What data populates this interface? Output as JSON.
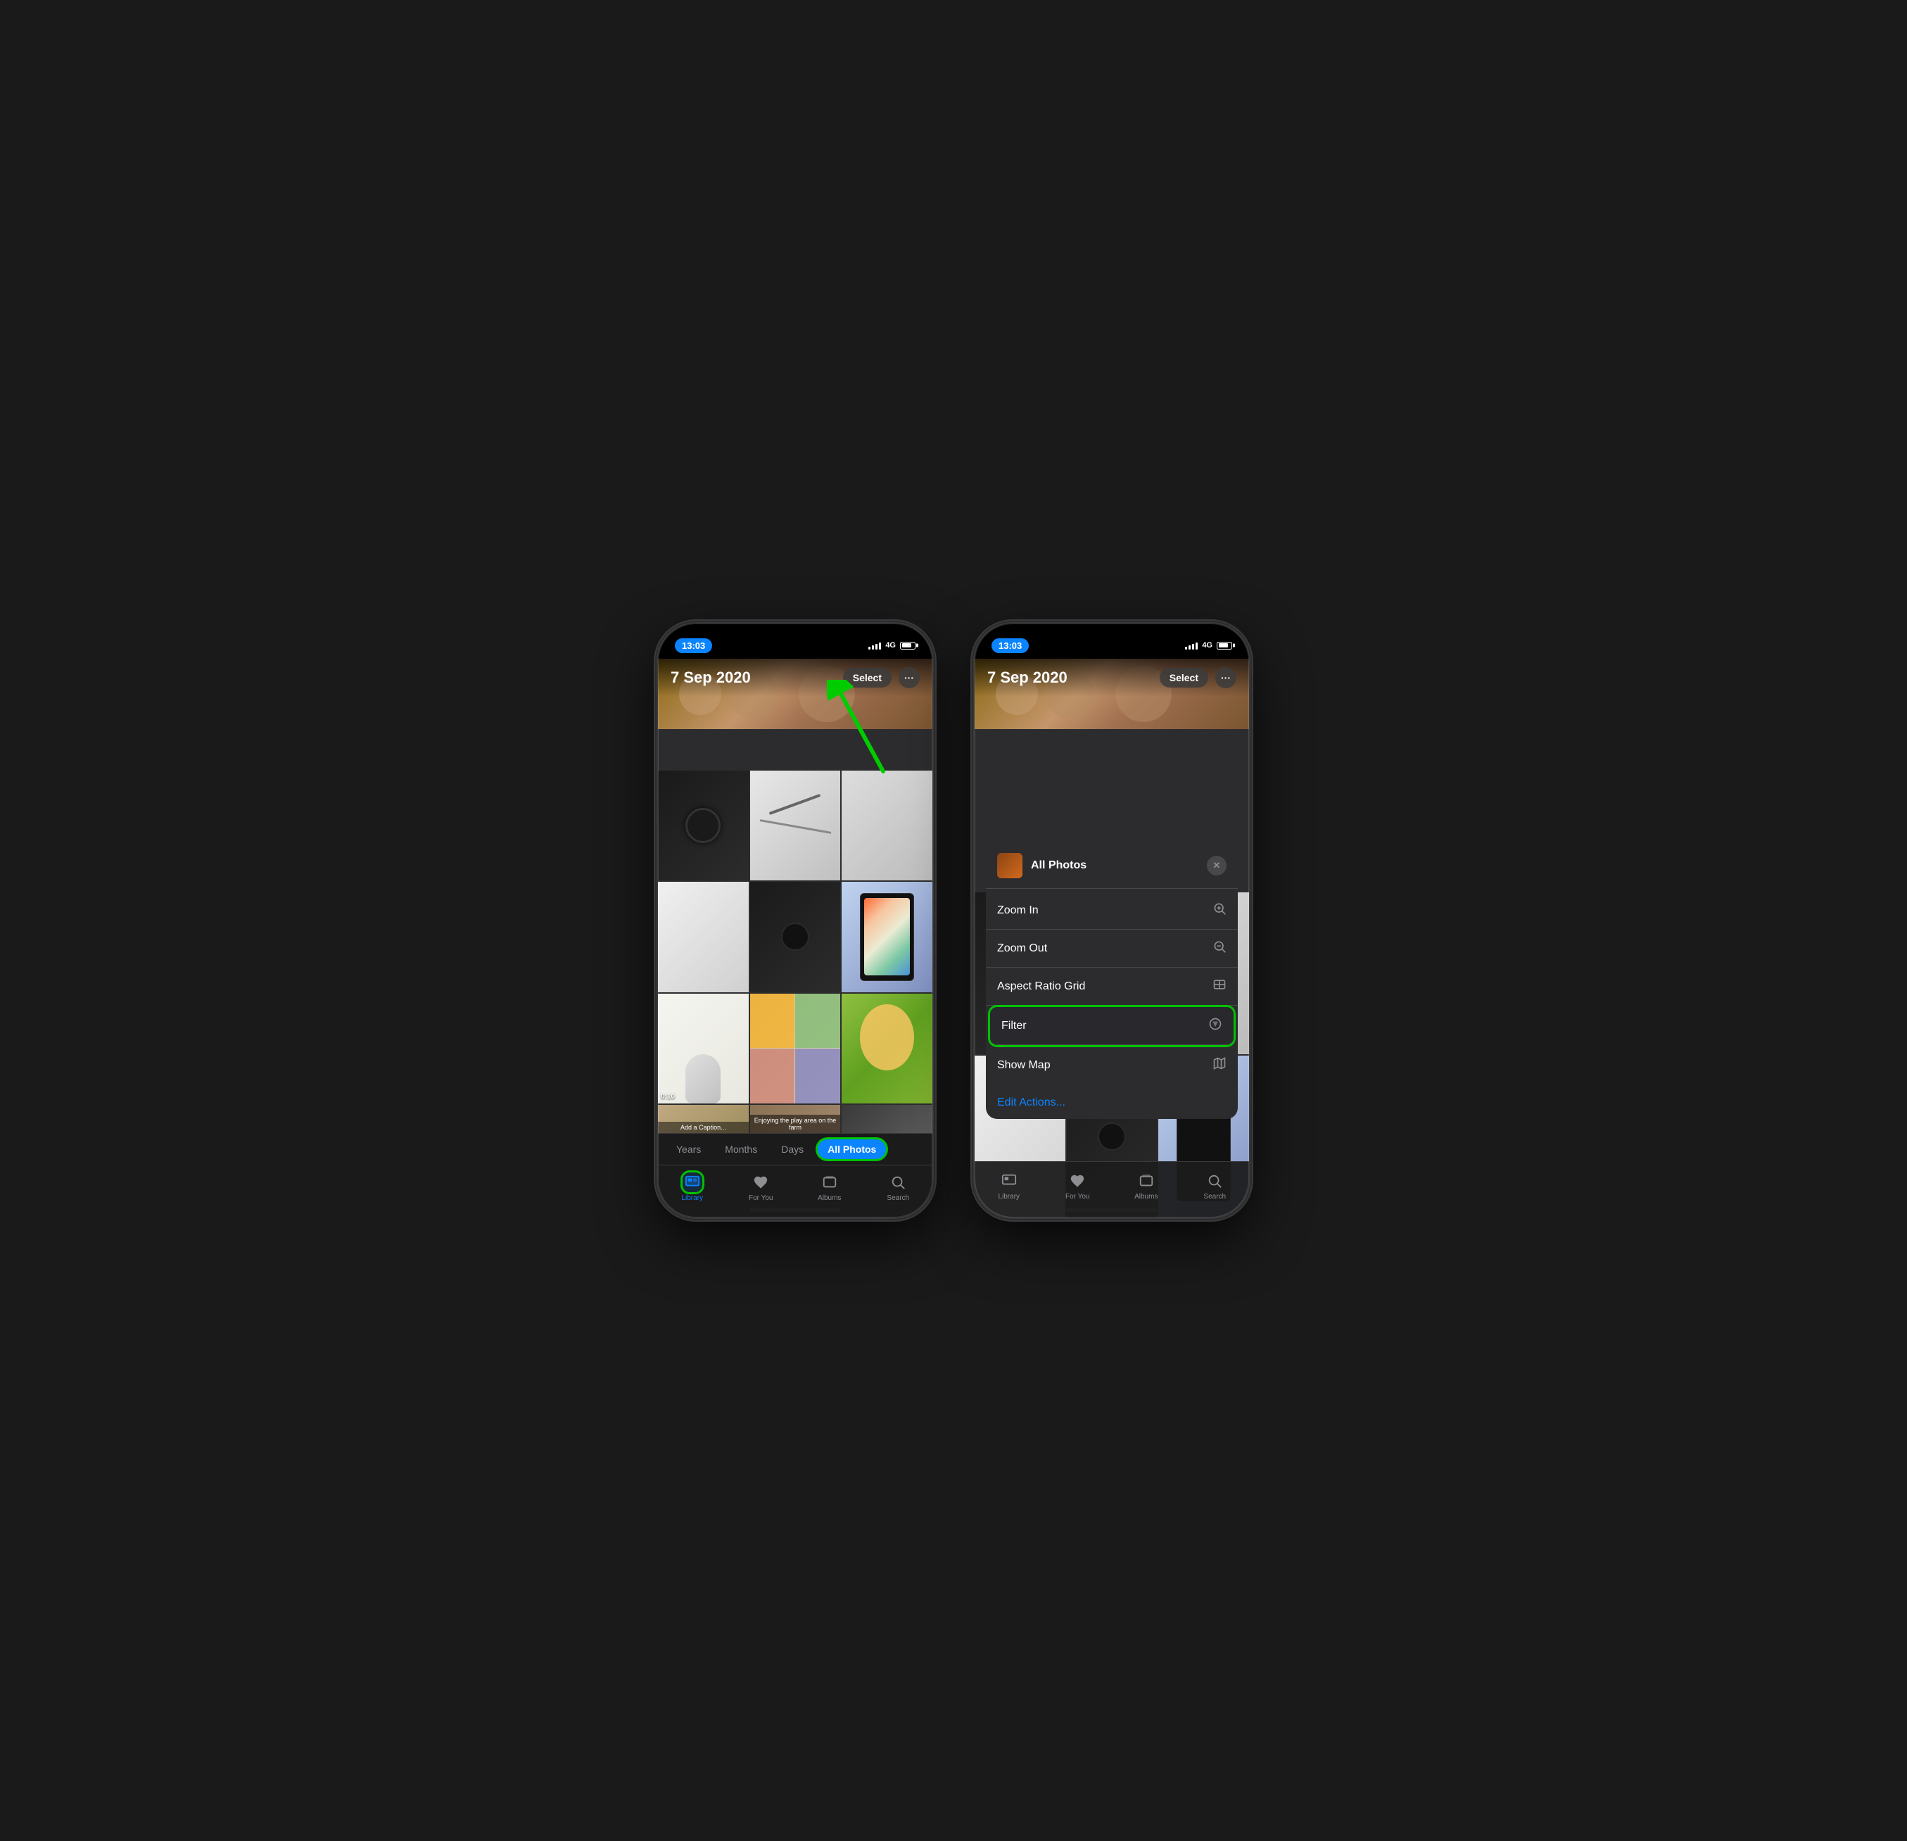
{
  "phones": [
    {
      "id": "left-phone",
      "statusBar": {
        "time": "13:03",
        "signal": "4G",
        "batteryLevel": 80
      },
      "header": {
        "date": "7 Sep 2020",
        "selectLabel": "Select",
        "moreLabel": "···"
      },
      "viewSwitcher": {
        "options": [
          "Years",
          "Months",
          "Days",
          "All Photos"
        ],
        "active": "All Photos"
      },
      "tabBar": {
        "items": [
          {
            "id": "library",
            "label": "Library",
            "icon": "🖼",
            "active": true
          },
          {
            "id": "for-you",
            "label": "For You",
            "icon": "❤",
            "active": false
          },
          {
            "id": "albums",
            "label": "Albums",
            "icon": "📁",
            "active": false
          },
          {
            "id": "search",
            "label": "Search",
            "icon": "🔍",
            "active": false
          }
        ]
      },
      "annotation": {
        "arrowTarget": "Select button",
        "hasGreenArrow": true
      }
    },
    {
      "id": "right-phone",
      "statusBar": {
        "time": "13:03",
        "signal": "4G",
        "batteryLevel": 80
      },
      "header": {
        "date": "7 Sep 2020",
        "selectLabel": "Select",
        "moreLabel": "···"
      },
      "contextMenu": {
        "title": "All Photos",
        "closeLabel": "✕",
        "items": [
          {
            "id": "zoom-in",
            "label": "Zoom In",
            "icon": "⊕"
          },
          {
            "id": "zoom-out",
            "label": "Zoom Out",
            "icon": "⊖"
          },
          {
            "id": "aspect-ratio-grid",
            "label": "Aspect Ratio Grid",
            "icon": "⊟"
          },
          {
            "id": "filter",
            "label": "Filter",
            "icon": "≡",
            "highlighted": true
          },
          {
            "id": "show-map",
            "label": "Show Map",
            "icon": "🗺"
          }
        ],
        "editActions": "Edit Actions..."
      },
      "tabBar": {
        "items": [
          {
            "id": "library",
            "label": "Library",
            "icon": "🖼",
            "active": false
          },
          {
            "id": "for-you",
            "label": "For You",
            "icon": "❤",
            "active": false
          },
          {
            "id": "albums",
            "label": "Albums",
            "icon": "📁",
            "active": false
          },
          {
            "id": "search",
            "label": "Search",
            "icon": "🔍",
            "active": false
          }
        ]
      }
    }
  ]
}
